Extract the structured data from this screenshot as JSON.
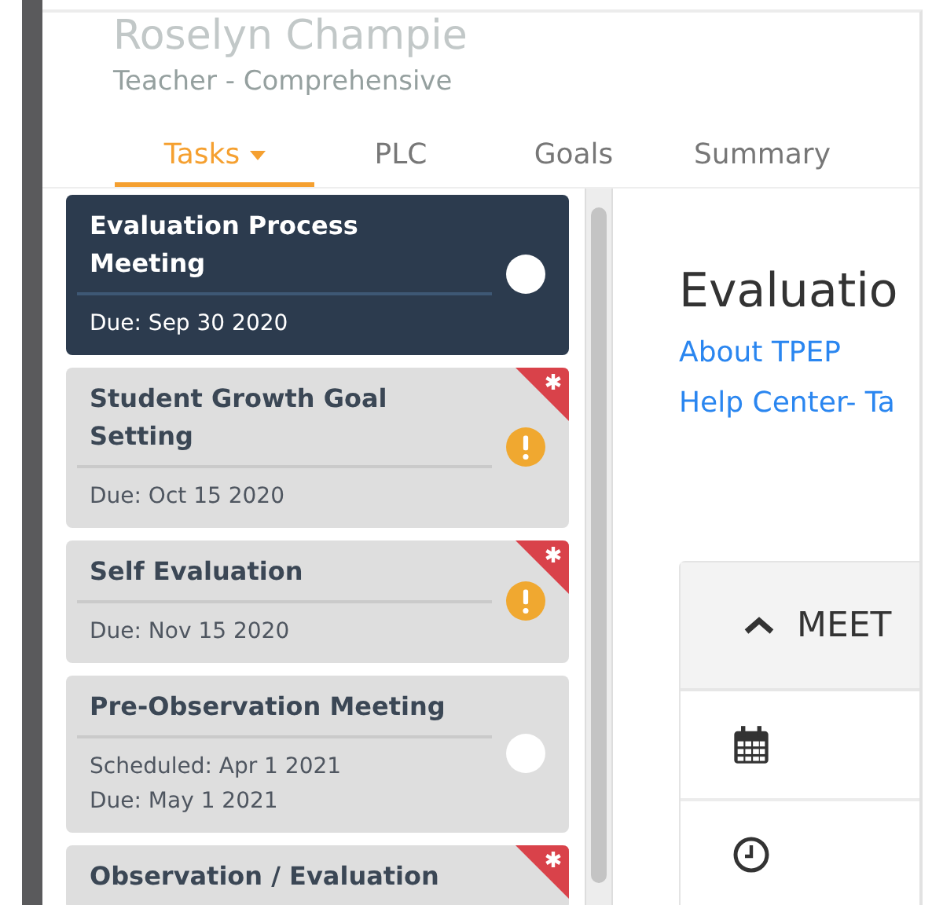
{
  "header": {
    "name": "Roselyn Champie",
    "role": "Teacher - Comprehensive"
  },
  "tabs": [
    {
      "label": "Tasks",
      "selected": true,
      "dropdown": true
    },
    {
      "label": "PLC",
      "selected": false,
      "dropdown": false
    },
    {
      "label": "Goals",
      "selected": false,
      "dropdown": false
    },
    {
      "label": "Summary",
      "selected": false,
      "dropdown": false
    }
  ],
  "tasks": [
    {
      "title": "Evaluation Process Meeting",
      "dates": [
        "Due: Sep 30 2020"
      ],
      "selected": true,
      "kind": "open",
      "flagged": false
    },
    {
      "title": "Student Growth Goal Setting",
      "dates": [
        "Due: Oct 15 2020"
      ],
      "selected": false,
      "kind": "warning",
      "flagged": true
    },
    {
      "title": "Self Evaluation",
      "dates": [
        "Due: Nov 15 2020"
      ],
      "selected": false,
      "kind": "warning",
      "flagged": true
    },
    {
      "title": "Pre-Observation Meeting",
      "dates": [
        "Scheduled: Apr 1 2021",
        "Due: May 1 2021"
      ],
      "selected": false,
      "kind": "open",
      "flagged": false
    },
    {
      "title": "Observation / Evaluation",
      "selected": false,
      "flagged": true
    }
  ],
  "content": {
    "heading": "Evaluatio",
    "links": [
      "About TPEP",
      "Help Center- Ta"
    ],
    "panel": {
      "title": "MEET",
      "expanded": true,
      "rows": [
        {
          "kind": "calendar"
        },
        {
          "kind": "clock"
        }
      ]
    }
  }
}
